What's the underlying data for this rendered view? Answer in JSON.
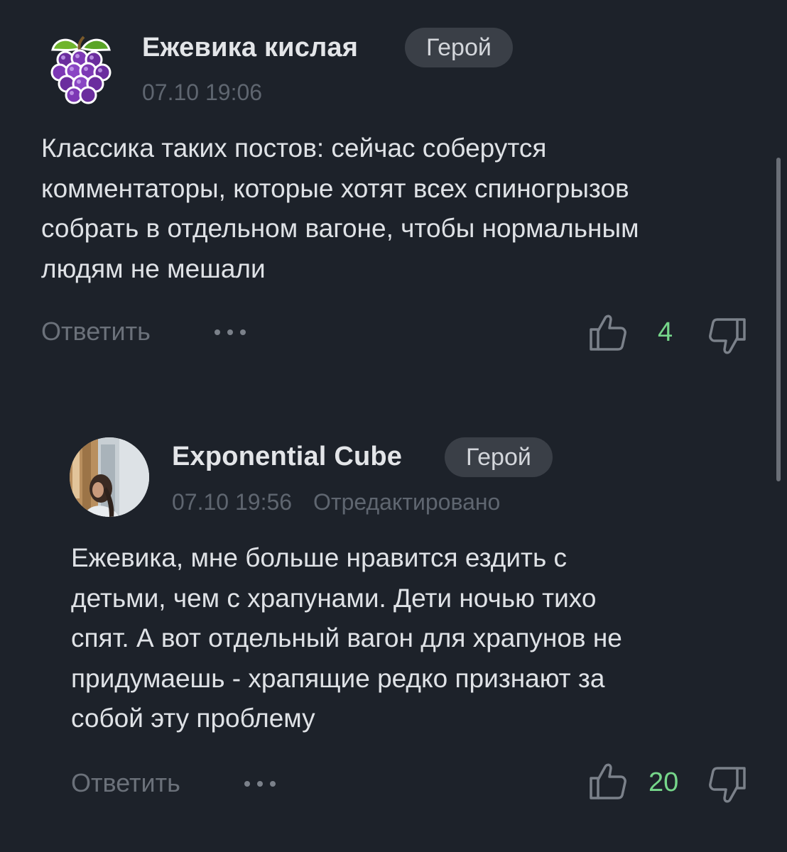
{
  "comments": [
    {
      "author": "Ежевика кислая",
      "badge": "Герой",
      "timestamp": "07.10 19:06",
      "edited": "",
      "body_lines": [
        "Классика таких постов: сейчас соберутся",
        "комментаторы, которые хотят всех спиногрызов",
        "собрать в отдельном вагоне, чтобы нормальным",
        "людям не мешали"
      ],
      "reply_label": "Ответить",
      "likes": "4",
      "avatar_icon": "grape-icon"
    },
    {
      "author": "Exponential Cube",
      "badge": "Герой",
      "timestamp": "07.10 19:56",
      "edited": "Отредактировано",
      "body_lines": [
        "Ежевика, мне больше нравится ездить с",
        "детьми, чем с храпунами. Дети ночью тихо",
        "спят. А вот отдельный вагон для храпунов не",
        "придумаешь - храпящие редко признают за",
        "собой эту проблему"
      ],
      "reply_label": "Ответить",
      "likes": "20",
      "avatar_icon": "user-photo"
    }
  ],
  "colors": {
    "background": "#1d222a",
    "badge_bg": "#3a3f47",
    "like_count": "#76d68a",
    "muted_text": "#5f6670"
  }
}
